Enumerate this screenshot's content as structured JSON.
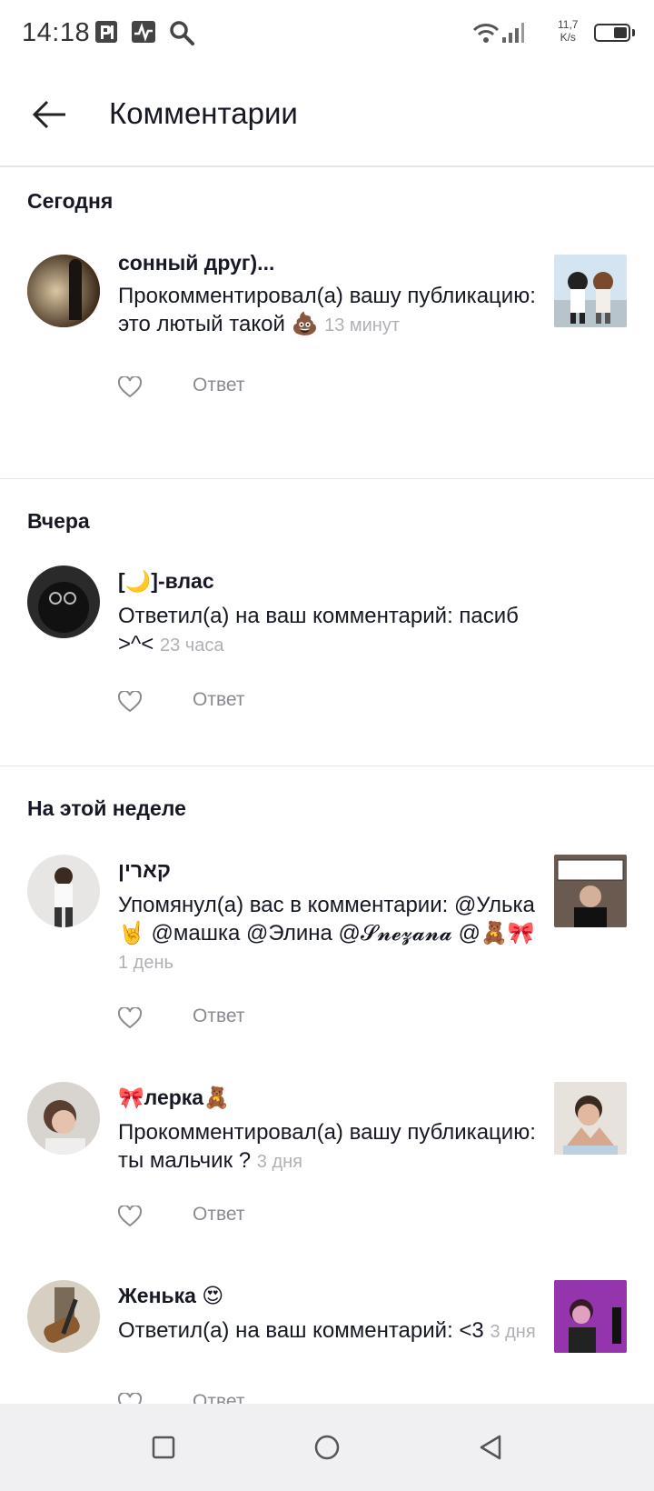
{
  "status_bar": {
    "time": "14:18",
    "speed_value": "11,7",
    "speed_unit": "K/s",
    "icons": [
      "parking-p-icon",
      "activity-monitor-icon",
      "search-icon",
      "wifi-icon",
      "signal-icon",
      "battery-icon"
    ]
  },
  "header": {
    "back_icon": "arrow-left-icon",
    "title": "Комментарии"
  },
  "sections": [
    {
      "title": "Сегодня",
      "items": [
        {
          "username": "сонный друг)...",
          "message": "Прокомментировал(а) вашу публикацию:  это лютый такой 💩",
          "time": "13 минут",
          "reply": "Ответ",
          "has_thumbnail": true
        }
      ]
    },
    {
      "title": "Вчера",
      "items": [
        {
          "username": "[🌙]-влас",
          "message": "Ответил(а) на ваш комментарий: пасиб >^<",
          "time": "23 часа",
          "reply": "Ответ",
          "has_thumbnail": false
        }
      ]
    },
    {
      "title": "На этой неделе",
      "items": [
        {
          "username": "קארין",
          "message": "Упомянул(а) вас в комментарии: @Улька🤘 @машка @Элина @𝓢𝓷𝓮𝔃𝓪𝓷𝓪 @🧸🎀",
          "time": "1 день",
          "reply": "Ответ",
          "has_thumbnail": true
        },
        {
          "username": "🎀лерка🧸",
          "message": "Прокомментировал(а) вашу публикацию:  ты мальчик ?",
          "time": "3 дня",
          "reply": "Ответ",
          "has_thumbnail": true
        },
        {
          "username": "Женька 😍",
          "message": "Ответил(а) на ваш комментарий: <3",
          "time": "3 дня",
          "reply": "Ответ",
          "has_thumbnail": true
        }
      ]
    }
  ],
  "nav_bar": {
    "icons": [
      "recent-apps-square-icon",
      "home-circle-icon",
      "back-triangle-icon"
    ]
  }
}
